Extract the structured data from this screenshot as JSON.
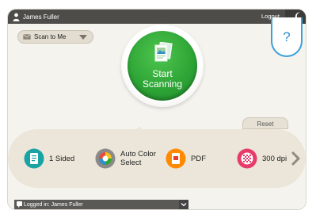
{
  "topbar": {
    "user_name": "James Fuller",
    "logout_label": "Logout"
  },
  "destination": {
    "label": "Scan to Me"
  },
  "help": {
    "label": "?"
  },
  "start_button": {
    "line1": "Start",
    "line2": "Scanning",
    "color": "#2ea636"
  },
  "reset": {
    "label": "Reset"
  },
  "settings": [
    {
      "label": "1 Sided",
      "icon": "document-sided-icon",
      "color": "#1aa3a3"
    },
    {
      "label_line1": "Auto Color",
      "label_line2": "Select",
      "icon": "color-wheel-icon",
      "color": "#8a8a8a"
    },
    {
      "label": "PDF",
      "icon": "pdf-icon",
      "color": "#ff8a00"
    },
    {
      "label": "300 dpi",
      "icon": "resolution-icon",
      "color": "#e63b6b"
    }
  ],
  "bottombar": {
    "status": "Logged in: James Fuller"
  }
}
